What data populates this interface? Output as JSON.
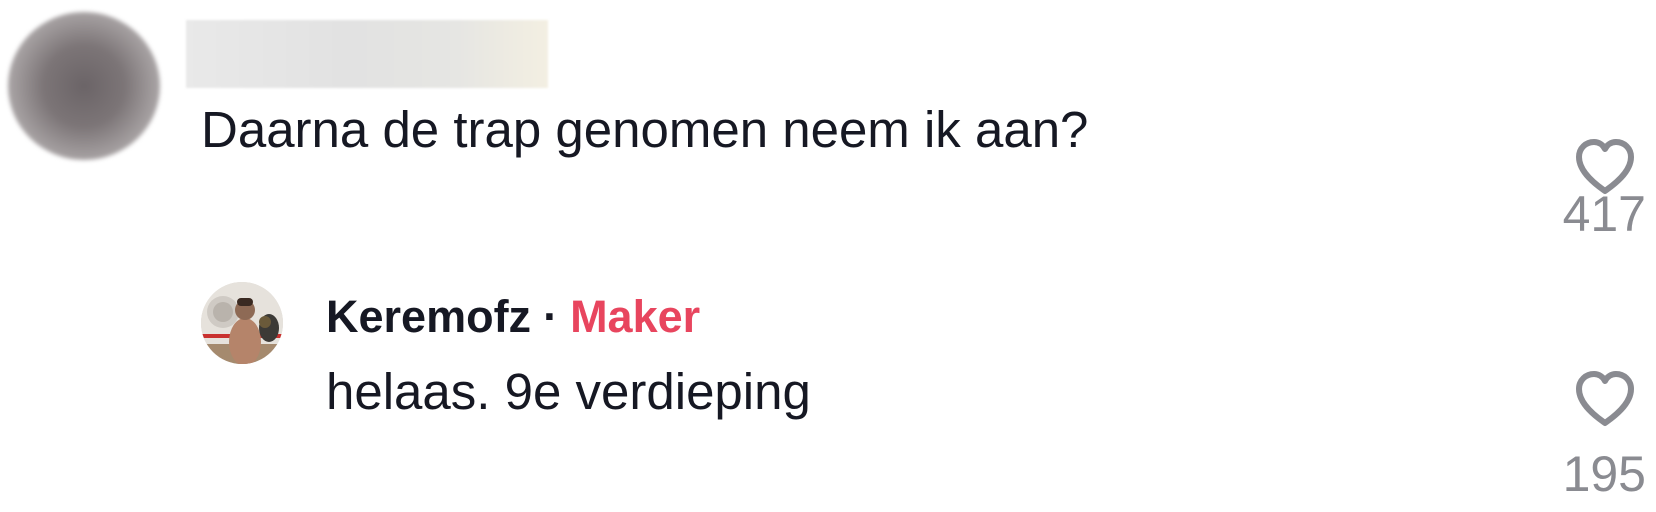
{
  "comments": [
    {
      "text": "Daarna de trap genomen neem ik aan?",
      "likes": "417",
      "like_icon": "heart-outline-icon"
    }
  ],
  "replies": [
    {
      "author": "Keremofz",
      "separator": "·",
      "badge": "Maker",
      "text": "helaas. 9e verdieping",
      "likes": "195",
      "like_icon": "heart-outline-icon"
    }
  ],
  "colors": {
    "text": "#161823",
    "muted": "#8a8b91",
    "badge": "#e8455e",
    "icon": "#8a8b91"
  }
}
